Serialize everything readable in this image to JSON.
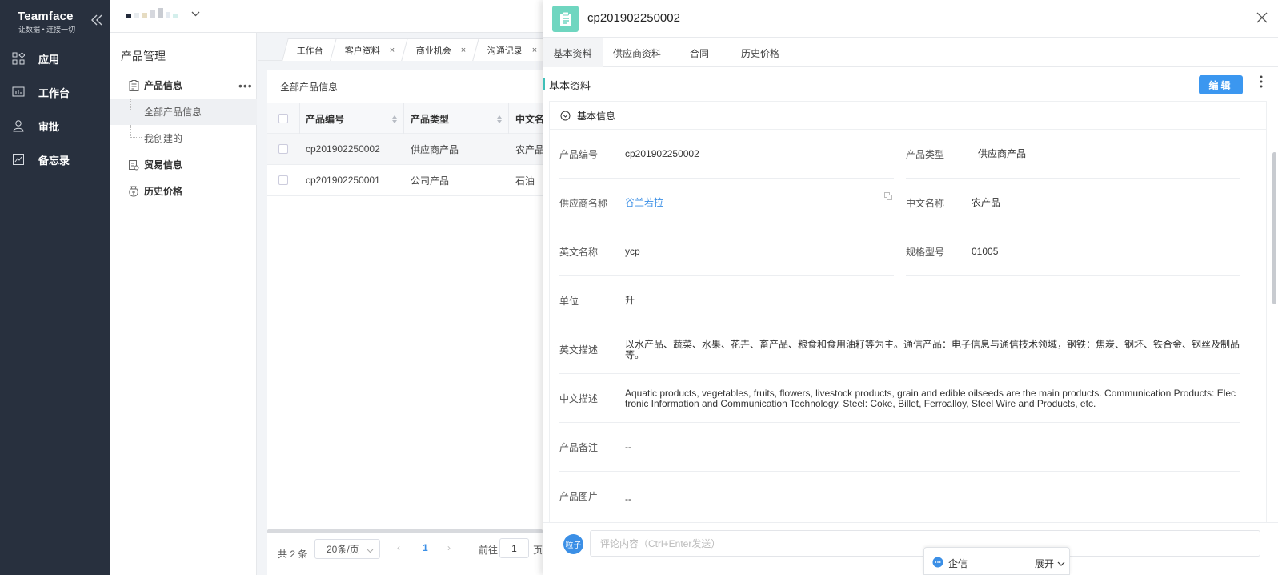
{
  "brand": {
    "name": "Teamface",
    "slogan": "让数据 • 连接一切"
  },
  "nav": {
    "items": [
      {
        "label": "应用",
        "icon": "apps-grid-icon"
      },
      {
        "label": "工作台",
        "icon": "dashboard-icon"
      },
      {
        "label": "审批",
        "icon": "approval-user-icon"
      },
      {
        "label": "备忘录",
        "icon": "memo-icon"
      }
    ]
  },
  "submenu": {
    "title": "产品管理",
    "items": [
      {
        "label": "产品信息",
        "icon": "product-doc-icon"
      },
      {
        "label": "全部产品信息"
      },
      {
        "label": "我创建的"
      },
      {
        "label": "贸易信息",
        "icon": "trade-icon"
      },
      {
        "label": "历史价格",
        "icon": "price-history-icon"
      }
    ],
    "more": "•••"
  },
  "tabs": [
    {
      "label": "工作台"
    },
    {
      "label": "客户资料",
      "close": "×"
    },
    {
      "label": "商业机会",
      "close": "×"
    },
    {
      "label": "沟通记录",
      "close": "×"
    }
  ],
  "list": {
    "title": "全部产品信息",
    "columns": [
      "产品编号",
      "产品类型",
      "中文名"
    ],
    "rows": [
      [
        "cp201902250002",
        "供应商产品",
        "农产品"
      ],
      [
        "cp201902250001",
        "公司产品",
        "石油"
      ]
    ]
  },
  "pager": {
    "total": "共 2 条",
    "size": "20条/页",
    "page": "1",
    "goto_label": "前往",
    "goto_value": "1",
    "page_suffix": "页"
  },
  "panel": {
    "title": "cp201902250002",
    "tabs": [
      "基本资料",
      "供应商资料",
      "合同",
      "历史价格"
    ],
    "section_title": "基本资料",
    "edit_label": "编辑",
    "group_title": "基本信息",
    "fields": {
      "product_no": {
        "label": "产品编号",
        "value": "cp201902250002"
      },
      "product_type": {
        "label": "产品类型",
        "value": "供应商产品"
      },
      "supplier": {
        "label": "供应商名称",
        "value": "谷兰若拉"
      },
      "cn_name": {
        "label": "中文名称",
        "value": "农产品"
      },
      "en_name": {
        "label": "英文名称",
        "value": "ycp"
      },
      "spec": {
        "label": "规格型号",
        "value": "01005"
      },
      "unit": {
        "label": "单位",
        "value": "升"
      },
      "en_desc": {
        "label": "英文描述",
        "value": "以水产品、蔬菜、水果、花卉、畜产品、粮食和食用油籽等为主。通信产品：电子信息与通信技术领域，钢铁：焦炭、钢坯、铁合金、钢丝及制品等。"
      },
      "cn_desc": {
        "label": "中文描述",
        "value": "Aquatic products, vegetables, fruits, flowers, livestock products, grain and edible oilseeds are the main products. Communication Products: Electronic Information and Communication Technology, Steel: Coke, Billet, Ferroalloy, Steel Wire and Products, etc."
      },
      "remark": {
        "label": "产品备注",
        "value": "--"
      },
      "image": {
        "label": "产品图片",
        "value": "--"
      }
    },
    "comment_avatar": "粒子",
    "comment_placeholder": "评论内容（Ctrl+Enter发送）"
  },
  "qixin": {
    "label": "企信",
    "expand": "展开"
  },
  "colors": {
    "nav_bg": "#28303e",
    "accent_blue": "#3b97f0",
    "accent_teal": "#6fd6c0",
    "link": "#3b8fe6"
  }
}
